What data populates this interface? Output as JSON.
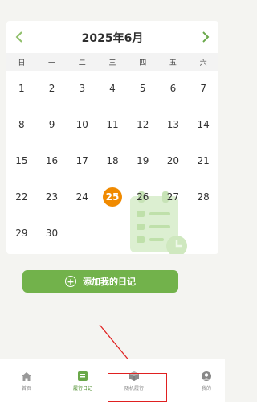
{
  "calendar": {
    "month_title": "2025年6月",
    "weekdays": [
      "日",
      "一",
      "二",
      "三",
      "四",
      "五",
      "六"
    ],
    "days": [
      [
        "1",
        "2",
        "3",
        "4",
        "5",
        "6",
        "7"
      ],
      [
        "8",
        "9",
        "10",
        "11",
        "12",
        "13",
        "14"
      ],
      [
        "15",
        "16",
        "17",
        "18",
        "19",
        "20",
        "21"
      ],
      [
        "22",
        "23",
        "24",
        "25",
        "26",
        "27",
        "28"
      ],
      [
        "29",
        "30",
        "",
        "",
        "",
        "",
        ""
      ]
    ],
    "selected_day": "25",
    "colors": {
      "accent": "#72b24b",
      "today": "#f08a00"
    }
  },
  "add_diary": {
    "label": "添加我的日记"
  },
  "tabs": [
    {
      "label": "首页",
      "icon": "home-icon"
    },
    {
      "label": "履行日记",
      "icon": "diary-icon"
    },
    {
      "label": "随机履行",
      "icon": "cube-icon"
    },
    {
      "label": "我的",
      "icon": "user-icon"
    }
  ]
}
